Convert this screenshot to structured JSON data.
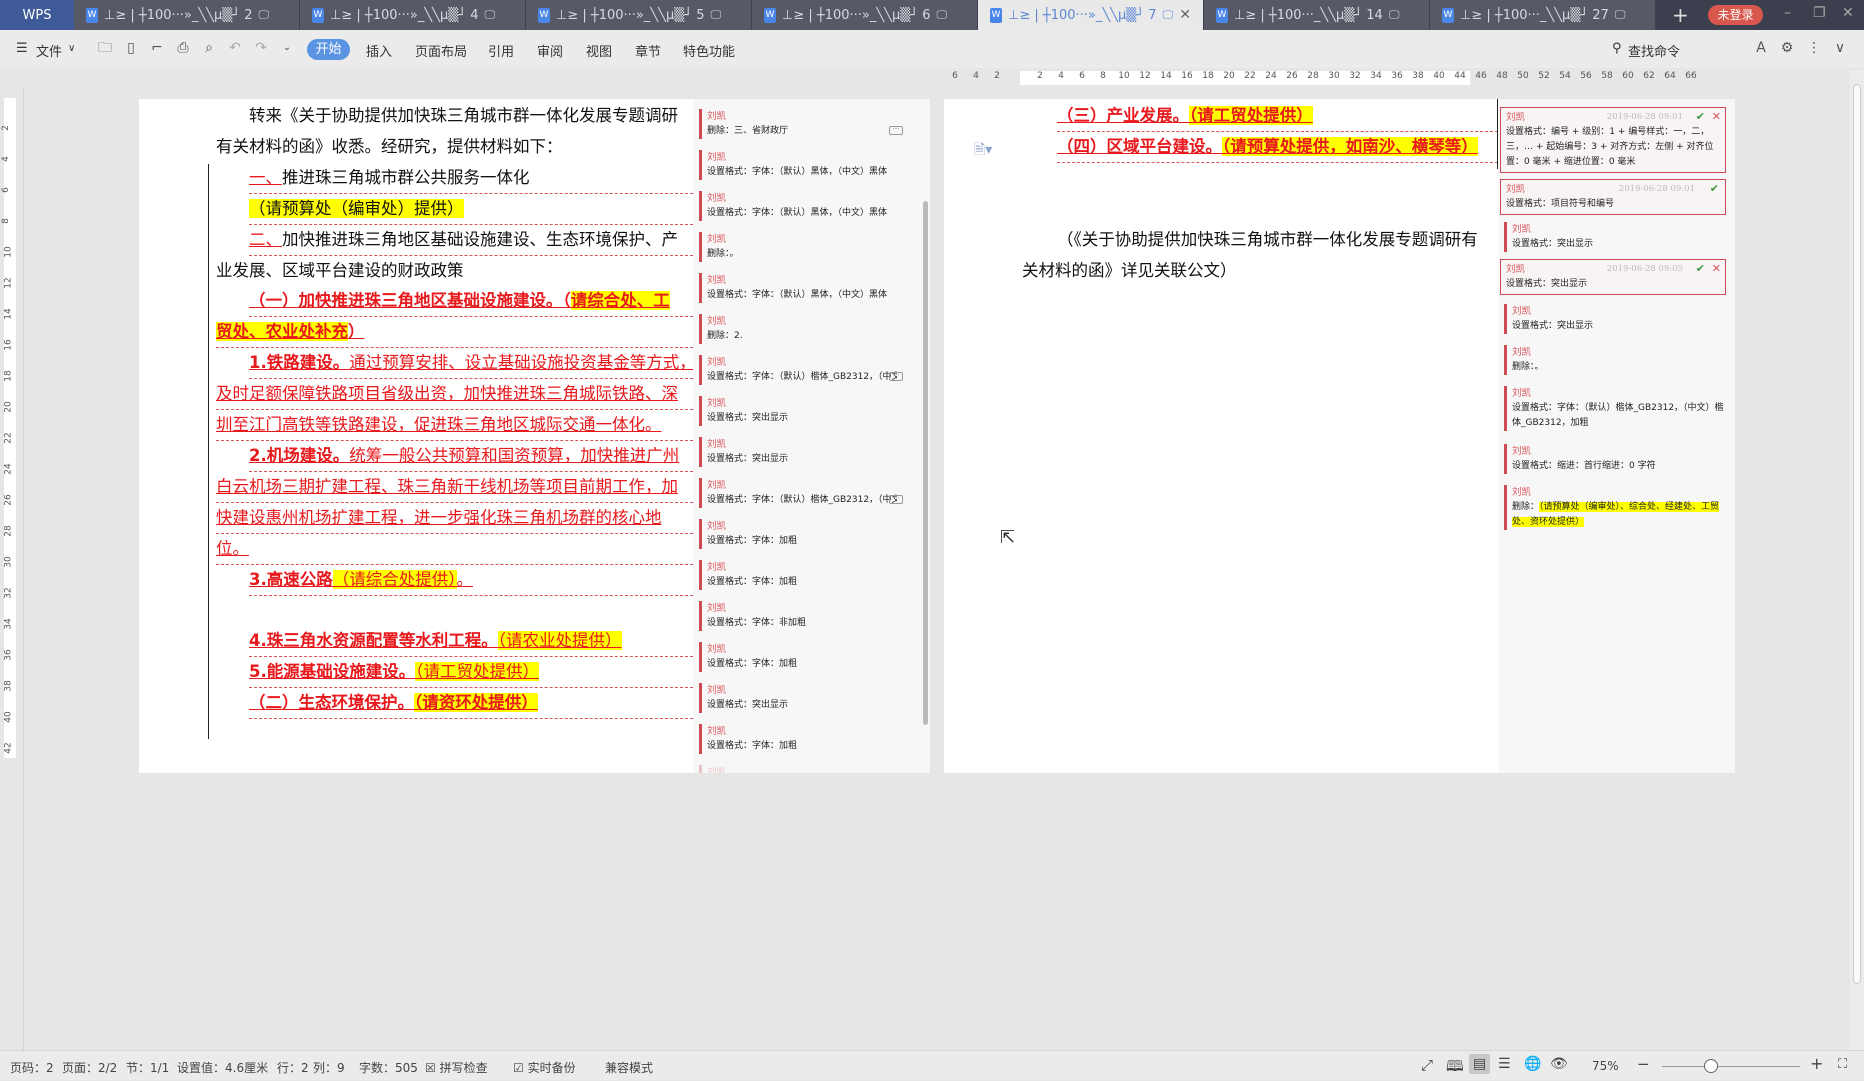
{
  "app": {
    "logo": "WPS",
    "login": "未登录",
    "new_tab": "+",
    "window_controls": [
      "–",
      "❐",
      "✕"
    ]
  },
  "tabs": [
    {
      "title": "⊥≥ | ┼100···»_╲╲µ▒┘ 2",
      "active": false
    },
    {
      "title": "⊥≥ | ┼100···»_╲╲µ▒┘ 4",
      "active": false
    },
    {
      "title": "⊥≥ | ┼100···»_╲╲µ▒┘ 5",
      "active": false
    },
    {
      "title": "⊥≥ | ┼100···»_╲╲µ▒┘ 6",
      "active": false
    },
    {
      "title": "⊥≥ | ┼100···»_╲╲µ▒┘ 7",
      "active": true
    },
    {
      "title": "⊥≥ | ┼100···_╲╲µ▒┘ 14",
      "active": false
    },
    {
      "title": "⊥≥ | ┼100···_╲╲µ▒┘ 27",
      "active": false
    }
  ],
  "toolbar": {
    "file": "文件",
    "menus": [
      "开始",
      "插入",
      "页面布局",
      "引用",
      "审阅",
      "视图",
      "章节",
      "特色功能"
    ],
    "search": "查找命令"
  },
  "ruler": {
    "top": [
      "6",
      "4",
      "2",
      "2",
      "4",
      "6",
      "8",
      "10",
      "12",
      "14",
      "16",
      "18",
      "20",
      "22",
      "24",
      "26",
      "28",
      "30",
      "32",
      "34",
      "36",
      "38",
      "40",
      "44",
      "46",
      "48",
      "50",
      "52",
      "54",
      "56",
      "58",
      "60",
      "62",
      "64",
      "66"
    ],
    "left": [
      "2",
      "4",
      "6",
      "8",
      "10",
      "12",
      "14",
      "16",
      "18",
      "20",
      "22",
      "24",
      "26",
      "28",
      "30",
      "32",
      "34",
      "36",
      "38",
      "40",
      "42"
    ]
  },
  "page1": {
    "lines": [
      {
        "indent": true,
        "segs": [
          {
            "t": "转来《关于协助提供加快珠三角城市群一体化发展专题调研",
            "s": "n"
          }
        ]
      },
      {
        "indent": false,
        "segs": [
          {
            "t": "有关材料的函》收悉。经研究，提供材料如下：",
            "s": "n"
          }
        ]
      },
      {
        "indent": true,
        "segs": [
          {
            "t": "一、",
            "s": "del"
          },
          {
            "t": "推进珠三角城市群公共服务一体化",
            "s": "n"
          }
        ]
      },
      {
        "indent": true,
        "segs": [
          {
            "t": "（请预算处（编审处）提供）",
            "s": "n",
            "hl": true
          }
        ]
      },
      {
        "indent": true,
        "segs": [
          {
            "t": "二、",
            "s": "del"
          },
          {
            "t": "加快推进珠三角地区基础设施建设、生态环境保护、产",
            "s": "n"
          }
        ]
      },
      {
        "indent": false,
        "segs": [
          {
            "t": "业发展、区域平台建设的财政政策",
            "s": "n"
          }
        ]
      },
      {
        "indent": true,
        "segs": [
          {
            "t": "（一）加快推进珠三角地区基础设施建设。（",
            "s": "rb"
          },
          {
            "t": "请综合处、工",
            "s": "rb",
            "hl": true
          }
        ]
      },
      {
        "indent": false,
        "segs": [
          {
            "t": "贸处、农业处补充",
            "s": "rb",
            "hl": true
          },
          {
            "t": "）",
            "s": "rb"
          }
        ]
      },
      {
        "indent": true,
        "segs": [
          {
            "t": "1.铁路建设。",
            "s": "rb"
          },
          {
            "t": "通过预算安排、设立基础设施投资基金等方式，",
            "s": "r"
          }
        ]
      },
      {
        "indent": false,
        "segs": [
          {
            "t": "及时足额保障铁路项目省级出资，加快推进珠三角城际铁路、深",
            "s": "r"
          }
        ]
      },
      {
        "indent": false,
        "segs": [
          {
            "t": "圳至江门高铁等铁路建设，促进珠三角地区城际交通一体化。",
            "s": "r"
          }
        ]
      },
      {
        "indent": true,
        "segs": [
          {
            "t": "2.机场建设。",
            "s": "rb"
          },
          {
            "t": "统筹一般公共预算和国资预算，加快推进广州",
            "s": "r"
          }
        ]
      },
      {
        "indent": false,
        "segs": [
          {
            "t": "白云机场三期扩建工程、珠三角新干线机场等项目前期工作，加",
            "s": "r"
          }
        ]
      },
      {
        "indent": false,
        "segs": [
          {
            "t": "快建设惠州机场扩建工程，进一步强化珠三角机场群的核心地",
            "s": "r"
          }
        ]
      },
      {
        "indent": false,
        "segs": [
          {
            "t": "位。",
            "s": "r"
          }
        ]
      },
      {
        "indent": true,
        "segs": [
          {
            "t": "3.高速公路",
            "s": "rb"
          },
          {
            "t": "（请综合处提供）",
            "s": "r",
            "hl": true
          },
          {
            "t": "。",
            "s": "r"
          }
        ]
      },
      {
        "indent": false,
        "segs": []
      },
      {
        "indent": true,
        "segs": [
          {
            "t": "4.珠三角水资源配置等水利工程。",
            "s": "rb"
          },
          {
            "t": "（请农业处提供）",
            "s": "r",
            "hl": true
          }
        ]
      },
      {
        "indent": true,
        "segs": [
          {
            "t": "5.能源基础设施建设。",
            "s": "rb"
          },
          {
            "t": "（请工贸处提供）",
            "s": "r",
            "hl": true
          }
        ]
      },
      {
        "indent": true,
        "segs": [
          {
            "t": "（二）生态环境保护。",
            "s": "rb"
          },
          {
            "t": "（请资环处提供）",
            "s": "rb",
            "hl": true
          }
        ]
      }
    ],
    "comments": [
      {
        "author": "刘凯",
        "text": "删除：三、省财政厅",
        "more": true
      },
      {
        "author": "刘凯",
        "text": "设置格式：字体：（默认）黑体，（中文）黑体"
      },
      {
        "author": "刘凯",
        "text": "设置格式：字体：（默认）黑体，（中文）黑体"
      },
      {
        "author": "刘凯",
        "text": "删除：。"
      },
      {
        "author": "刘凯",
        "text": "设置格式：字体：（默认）黑体，（中文）黑体"
      },
      {
        "author": "刘凯",
        "text": "删除：2."
      },
      {
        "author": "刘凯",
        "text": "设置格式：字体：（默认）楷体_GB2312，（中文",
        "more": true
      },
      {
        "author": "刘凯",
        "text": "设置格式：突出显示"
      },
      {
        "author": "刘凯",
        "text": "设置格式：突出显示"
      },
      {
        "author": "刘凯",
        "text": "设置格式：字体：（默认）楷体_GB2312，（中文",
        "more": true
      },
      {
        "author": "刘凯",
        "text": "设置格式：字体：加粗"
      },
      {
        "author": "刘凯",
        "text": "设置格式：字体：加粗"
      },
      {
        "author": "刘凯",
        "text": "设置格式：字体：非加粗"
      },
      {
        "author": "刘凯",
        "text": "设置格式：字体：加粗"
      },
      {
        "author": "刘凯",
        "text": "设置格式：突出显示"
      },
      {
        "author": "刘凯",
        "text": "设置格式：字体：加粗"
      },
      {
        "author": "刘凯",
        "text": ""
      }
    ]
  },
  "page2": {
    "lines": [
      {
        "indent": true,
        "segs": [
          {
            "t": "（三）产业发展。",
            "s": "rb"
          },
          {
            "t": "（请工贸处提供）",
            "s": "rb",
            "hl": true
          }
        ]
      },
      {
        "indent": true,
        "segs": [
          {
            "t": "（四）区域平台建设。",
            "s": "rb"
          },
          {
            "t": "（请预算处提供，如南沙、横琴等）",
            "s": "rb",
            "hl": true
          }
        ]
      },
      {
        "indent": false,
        "segs": []
      },
      {
        "indent": false,
        "segs": []
      },
      {
        "indent": true,
        "segs": [
          {
            "t": "（《关于协助提供加快珠三角城市群一体化发展专题调研有",
            "s": "n"
          }
        ]
      },
      {
        "indent": false,
        "segs": [
          {
            "t": "关材料的函》详见关联公文）",
            "s": "n"
          }
        ]
      }
    ],
    "comments": [
      {
        "author": "刘凯",
        "text": "设置格式：编号 + 级别：1 + 编号样式：一，二，三，… + 起始编号：3 + 对齐方式：左侧 + 对齐位置：0 毫米 + 缩进位置：0 毫米",
        "date": "2019-06-28 09:01",
        "boxed": true,
        "accept": true,
        "reject": true
      },
      {
        "author": "刘凯",
        "text": "设置格式：项目符号和编号",
        "date": "2019-06-28 09:01",
        "boxed": true,
        "accept": true
      },
      {
        "author": "刘凯",
        "text": "设置格式：突出显示"
      },
      {
        "author": "刘凯",
        "text": "设置格式：突出显示",
        "date": "2019-06-28 09:05",
        "boxed": true,
        "accept": true,
        "reject": true
      },
      {
        "author": "刘凯",
        "text": "设置格式：突出显示"
      },
      {
        "author": "刘凯",
        "text": "删除：。"
      },
      {
        "author": "刘凯",
        "text": "设置格式：字体：（默认）楷体_GB2312，（中文）楷体_GB2312，加粗"
      },
      {
        "author": "刘凯",
        "text": "设置格式：缩进：首行缩进：0 字符"
      },
      {
        "author": "刘凯",
        "text": "删除：",
        "hltext": "（请预算处（编审处）、综合处、经建处、工贸处、资环处提供）"
      }
    ]
  },
  "status": {
    "page_no": "页码：2",
    "pages": "页面：2/2",
    "section": "节：1/1",
    "setting": "设置值：4.6厘米",
    "row": "行：2",
    "col": "列：9",
    "words": "字数：505",
    "spell": "拼写检查",
    "backup": "实时备份",
    "compat": "兼容模式",
    "zoom": "75%",
    "zoom_level_percent": 75
  },
  "colors": {
    "accent": "#5b93e3",
    "revision": "#e8191c",
    "highlight": "#ffff00",
    "tabbar": "#3c3f4d"
  }
}
